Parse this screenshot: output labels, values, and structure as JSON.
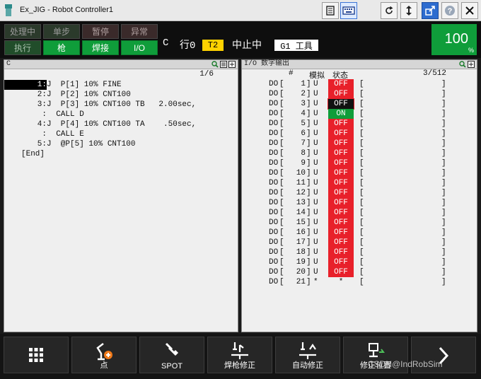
{
  "window": {
    "title": "Ex_JIG - Robot Controller1"
  },
  "status_buttons": {
    "row1": [
      "处理中",
      "单步",
      "暂停",
      "异常"
    ],
    "row2": [
      "执行",
      "枪",
      "焊接",
      "I/O"
    ]
  },
  "status_line": {
    "prog": "C",
    "line_label": "行0",
    "mode": "T2",
    "state": "中止中",
    "tool": "G1 工具"
  },
  "override": {
    "value": "100",
    "unit": "%"
  },
  "program_pane": {
    "title": "C",
    "position": "1/6",
    "lines": [
      {
        "num": "1:",
        "text": "J  P[1] 10% FINE"
      },
      {
        "num": "2:",
        "text": "J  P[2] 10% CNT100"
      },
      {
        "num": "3:",
        "text": "J  P[3] 10% CNT100 TB   2.00sec,"
      },
      {
        "num": ":",
        "text": "  CALL D"
      },
      {
        "num": "4:",
        "text": "J  P[4] 10% CNT100 TA    .50sec,"
      },
      {
        "num": ":",
        "text": "  CALL E"
      },
      {
        "num": "5:",
        "text": "J  @P[5] 10% CNT100"
      },
      {
        "num": "",
        "text": "[End]"
      }
    ]
  },
  "io_pane": {
    "title": "I/O 数字输出",
    "headers": {
      "num": "#",
      "sim": "模拟",
      "state": "状态"
    },
    "position": "3/512",
    "rows": [
      {
        "type": "DO",
        "num": "1",
        "sim": "U",
        "state": "OFF"
      },
      {
        "type": "DO",
        "num": "2",
        "sim": "U",
        "state": "OFF"
      },
      {
        "type": "DO",
        "num": "3",
        "sim": "U",
        "state": "OFF"
      },
      {
        "type": "DO",
        "num": "4",
        "sim": "U",
        "state": "ON"
      },
      {
        "type": "DO",
        "num": "5",
        "sim": "U",
        "state": "OFF"
      },
      {
        "type": "DO",
        "num": "6",
        "sim": "U",
        "state": "OFF"
      },
      {
        "type": "DO",
        "num": "7",
        "sim": "U",
        "state": "OFF"
      },
      {
        "type": "DO",
        "num": "8",
        "sim": "U",
        "state": "OFF"
      },
      {
        "type": "DO",
        "num": "9",
        "sim": "U",
        "state": "OFF"
      },
      {
        "type": "DO",
        "num": "10",
        "sim": "U",
        "state": "OFF"
      },
      {
        "type": "DO",
        "num": "11",
        "sim": "U",
        "state": "OFF"
      },
      {
        "type": "DO",
        "num": "12",
        "sim": "U",
        "state": "OFF"
      },
      {
        "type": "DO",
        "num": "13",
        "sim": "U",
        "state": "OFF"
      },
      {
        "type": "DO",
        "num": "14",
        "sim": "U",
        "state": "OFF"
      },
      {
        "type": "DO",
        "num": "15",
        "sim": "U",
        "state": "OFF"
      },
      {
        "type": "DO",
        "num": "16",
        "sim": "U",
        "state": "OFF"
      },
      {
        "type": "DO",
        "num": "17",
        "sim": "U",
        "state": "OFF"
      },
      {
        "type": "DO",
        "num": "18",
        "sim": "U",
        "state": "OFF"
      },
      {
        "type": "DO",
        "num": "19",
        "sim": "U",
        "state": "OFF"
      },
      {
        "type": "DO",
        "num": "20",
        "sim": "U",
        "state": "OFF"
      },
      {
        "type": "DO",
        "num": "21",
        "sim": "*",
        "state": "*"
      }
    ]
  },
  "function_keys": [
    {
      "label": "",
      "icon": "grid-menu-icon"
    },
    {
      "label": "点",
      "icon": "robot-add-point-icon"
    },
    {
      "label": "SPOT",
      "icon": "spot-gun-icon"
    },
    {
      "label": "焊枪修正",
      "icon": "gun-correction-icon"
    },
    {
      "label": "自动修正",
      "icon": "auto-correction-icon"
    },
    {
      "label": "修正位置",
      "icon": "correct-position-icon"
    },
    {
      "label": "",
      "icon": "next-arrow-icon"
    }
  ],
  "watermark": "CSDN@IndRobSim",
  "colors": {
    "off": "#e8202a",
    "on": "#0f9d3a",
    "mode": "#ffd200"
  }
}
